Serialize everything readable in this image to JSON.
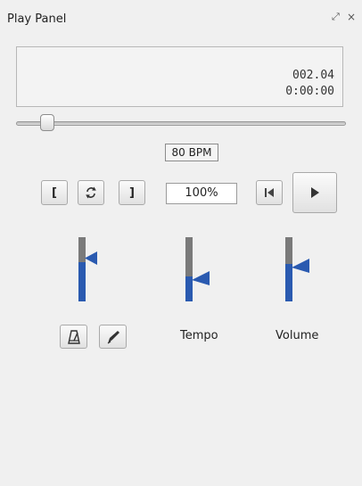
{
  "window": {
    "title": "Play Panel",
    "float_glyph": "⤢",
    "close_glyph": "×"
  },
  "display": {
    "measure": "002.04",
    "time": "0:00:00"
  },
  "position_slider": {
    "value": 0.1
  },
  "tempo": {
    "bpm_text": "80 BPM",
    "percent_text": "100%",
    "slider_level": 0.3
  },
  "buttons": {
    "loop_in_label": "[",
    "loop_out_label": "]",
    "loop_toggle_icon": "loop-icon",
    "rewind_icon": "rewind-to-start-icon",
    "play_icon": "play-icon",
    "metronome_icon": "metronome-icon",
    "count_in_icon": "count-in-icon"
  },
  "sliders": {
    "main_level": 0.55,
    "tempo_level": 0.3,
    "volume_level": 0.5
  },
  "labels": {
    "tempo": "Tempo",
    "volume": "Volume"
  },
  "colors": {
    "slider_fill": "#2a5ab0",
    "slider_track": "#7a7a7a"
  }
}
